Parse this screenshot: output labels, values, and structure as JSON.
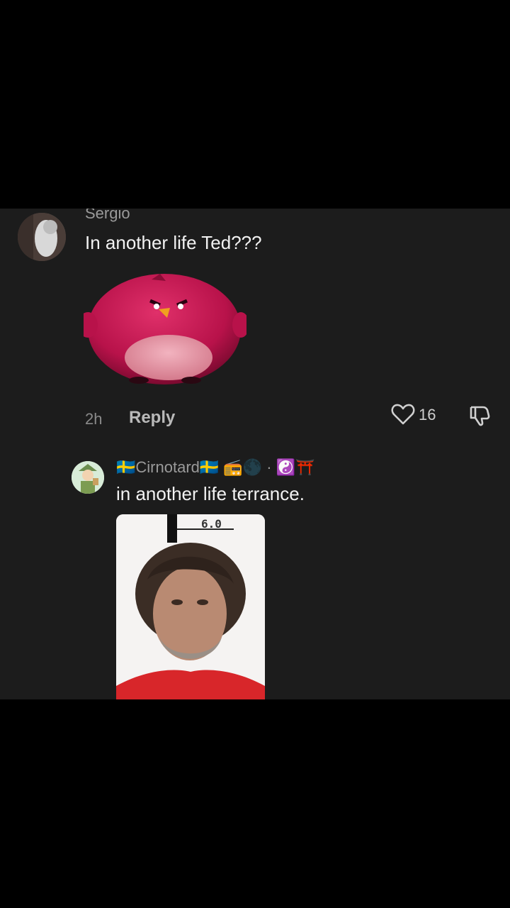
{
  "comment1": {
    "username": "Sergio",
    "text": "In another life Ted???",
    "sticker": "red-bird-sticker",
    "time": "2h",
    "reply_label": "Reply",
    "like_count": "16"
  },
  "comment2": {
    "username": "🇸🇪Cirnotard🇸🇪 📻🌑 · ☯️⛩️",
    "text": "in another life terrance.",
    "photo_label": "6.0"
  },
  "colors": {
    "background": "#000000",
    "panel": "#1c1c1c",
    "muted_text": "#9a9a9a",
    "primary_text": "#f2f2f2"
  }
}
